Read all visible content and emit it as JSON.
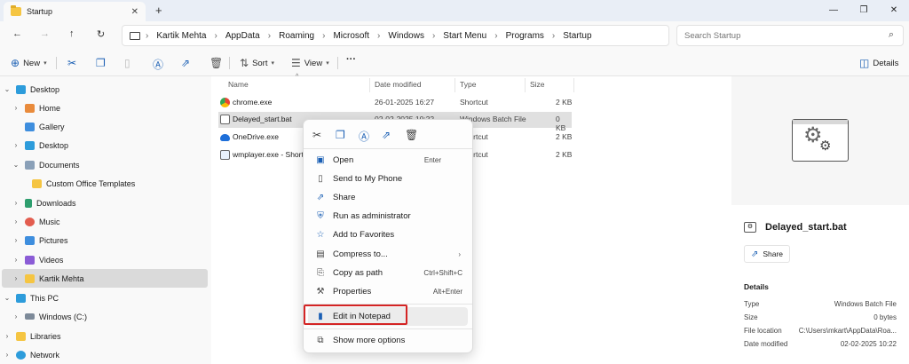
{
  "window": {
    "tab_title": "Startup",
    "new_tab": "+",
    "close_tab": "✕",
    "minimize": "—",
    "maximize": "❐",
    "close": "✕"
  },
  "nav": {
    "back": "←",
    "forward": "→",
    "up": "↑",
    "refresh": "↻"
  },
  "breadcrumb": [
    "Kartik Mehta",
    "AppData",
    "Roaming",
    "Microsoft",
    "Windows",
    "Start Menu",
    "Programs",
    "Startup"
  ],
  "search": {
    "placeholder": "Search Startup"
  },
  "toolbar": {
    "new_label": "New",
    "sort_label": "Sort",
    "view_label": "View",
    "more": "···",
    "details_label": "Details"
  },
  "sidebar": {
    "items": [
      {
        "label": "Desktop",
        "icon": "desktop-icon"
      },
      {
        "label": "Home",
        "icon": "home-icon"
      },
      {
        "label": "Gallery",
        "icon": "gallery-icon"
      },
      {
        "label": "Desktop",
        "icon": "desktop-icon"
      },
      {
        "label": "Documents",
        "icon": "documents-icon"
      },
      {
        "label": "Custom Office Templates",
        "icon": "folder-icon"
      },
      {
        "label": "Downloads",
        "icon": "downloads-icon"
      },
      {
        "label": "Music",
        "icon": "music-icon"
      },
      {
        "label": "Pictures",
        "icon": "pictures-icon"
      },
      {
        "label": "Videos",
        "icon": "videos-icon"
      },
      {
        "label": "Kartik Mehta",
        "icon": "folder-icon"
      },
      {
        "label": "This PC",
        "icon": "pc-icon"
      },
      {
        "label": "Windows (C:)",
        "icon": "drive-icon"
      },
      {
        "label": "Libraries",
        "icon": "libraries-icon"
      },
      {
        "label": "Network",
        "icon": "network-icon"
      }
    ]
  },
  "file_list": {
    "columns": [
      "Name",
      "Date modified",
      "Type",
      "Size"
    ],
    "rows": [
      {
        "name": "chrome.exe",
        "date": "26-01-2025 16:27",
        "type": "Shortcut",
        "size": "2 KB"
      },
      {
        "name": "Delayed_start.bat",
        "date": "02-02-2025 10:22",
        "type": "Windows Batch File",
        "size": "0 KB"
      },
      {
        "name": "OneDrive.exe",
        "date": "",
        "type": "Shortcut",
        "size": "2 KB"
      },
      {
        "name": "wmplayer.exe - Shortc",
        "date": "",
        "type": "Shortcut",
        "size": "2 KB"
      }
    ]
  },
  "context_menu": {
    "items": [
      {
        "label": "Open",
        "shortcut": "Enter"
      },
      {
        "label": "Send to My Phone",
        "shortcut": ""
      },
      {
        "label": "Share",
        "shortcut": ""
      },
      {
        "label": "Run as administrator",
        "shortcut": ""
      },
      {
        "label": "Add to Favorites",
        "shortcut": ""
      },
      {
        "label": "Compress to...",
        "shortcut": ""
      },
      {
        "label": "Copy as path",
        "shortcut": "Ctrl+Shift+C"
      },
      {
        "label": "Properties",
        "shortcut": "Alt+Enter"
      },
      {
        "label": "Edit in Notepad",
        "shortcut": ""
      },
      {
        "label": "Show more options",
        "shortcut": ""
      }
    ],
    "highlight_color": "#d42424"
  },
  "details": {
    "file_name": "Delayed_start.bat",
    "share_label": "Share",
    "heading": "Details",
    "fields": [
      {
        "key": "Type",
        "value": "Windows Batch File"
      },
      {
        "key": "Size",
        "value": "0 bytes"
      },
      {
        "key": "File location",
        "value": "C:\\Users\\mkart\\AppData\\Roa..."
      },
      {
        "key": "Date modified",
        "value": "02-02-2025 10:22"
      }
    ]
  },
  "colors": {
    "accent": "#1a5fb4",
    "folder": "#f5c542"
  }
}
